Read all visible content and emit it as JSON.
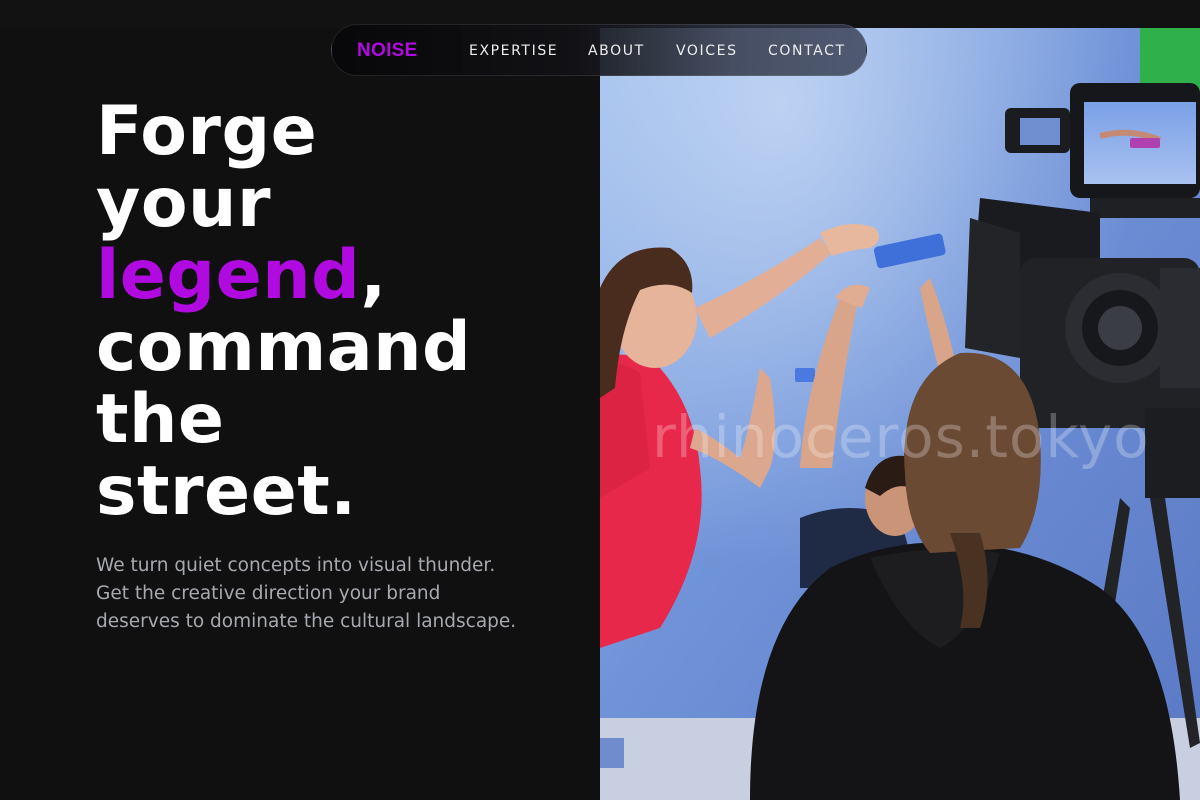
{
  "nav": {
    "brand": "NOISE",
    "links": [
      "EXPERTISE",
      "ABOUT",
      "VOICES",
      "CONTACT"
    ]
  },
  "hero": {
    "headline": {
      "line1": "Forge",
      "line2": "your",
      "accent": "legend",
      "accent_suffix": ",",
      "line4": "command",
      "line5": "the",
      "line6": "street."
    },
    "subtitle": "We turn quiet concepts into visual thunder. Get the creative direction your brand deserves to dominate the cultural landscape.",
    "image": {
      "watermark": "rhinoceros.tokyo"
    }
  },
  "colors": {
    "background": "#101011",
    "accent": "#b10ae0",
    "headline": "#ffffff",
    "body_text": "#a7a9b0"
  }
}
